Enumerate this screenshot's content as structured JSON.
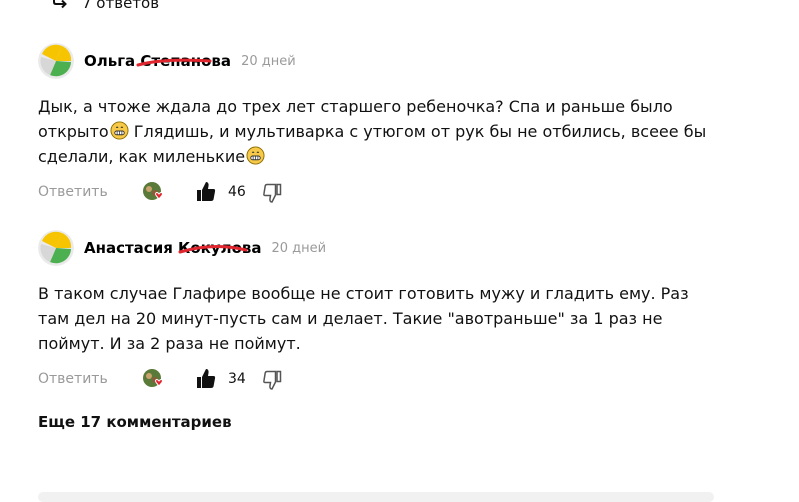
{
  "replies_link": {
    "label": "7 ответов"
  },
  "comments": [
    {
      "author": "Ольга Степанова",
      "date": "20 дней",
      "text_parts": [
        "Дык, а чтоже ждала до трех лет старшего ребеночка? Спа и раньше было открыто",
        " Глядишь, и мультиварка с утюгом от рук бы не отбились, всеее бы сделали, как миленькие"
      ],
      "emojis": [
        "grinning-face-emoji",
        "grinning-face-emoji"
      ],
      "reply_label": "Ответить",
      "likes": "46"
    },
    {
      "author": "Анастасия Кокулова",
      "date": "20 дней",
      "text": "В таком случае Глафире вообще не стоит готовить мужу и гладить ему. Раз там дел на 20 минут-пусть сам и делает. Такие \"авотраньше\" за 1 раз не поймут. И за 2 раза не поймут.",
      "reply_label": "Ответить",
      "likes": "34"
    }
  ],
  "more_comments": {
    "label": "Еще 17 комментариев"
  },
  "icons": {
    "reply_arrow": "reply-arrow-icon",
    "like": "thumbs-up-icon",
    "dislike": "thumbs-down-icon",
    "reactions": "reactions-icon"
  },
  "colors": {
    "avatar_yellow": "#f6c400",
    "avatar_green": "#4caf50",
    "avatar_grey": "#d7d7d7",
    "strike_red": "#e0262e",
    "meta_grey": "#9a9a9a"
  }
}
